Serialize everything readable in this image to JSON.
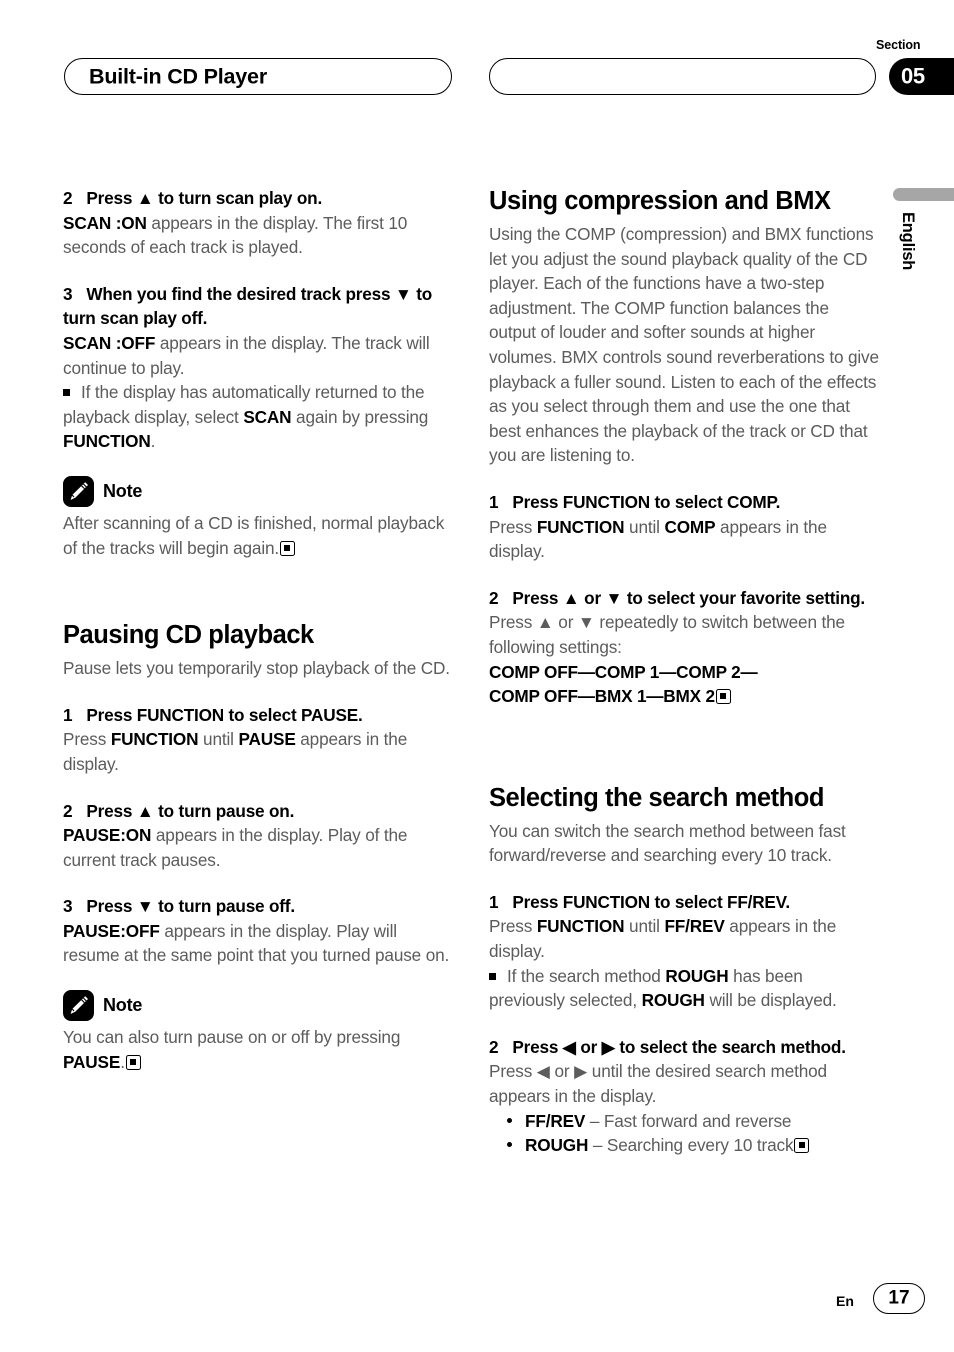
{
  "header": {
    "chapter_title": "Built-in CD Player",
    "section_label": "Section",
    "section_number": "05",
    "language_tab": "English"
  },
  "footer": {
    "language_code": "En",
    "page_number": "17"
  },
  "left_column": {
    "step2": {
      "number": "2",
      "heading": "Press ▲ to turn scan play on.",
      "body_bold": "SCAN :ON",
      "body_rest": " appears in the display. The first 10 seconds of each track is played."
    },
    "step3": {
      "number": "3",
      "heading": "When you find the desired track press ▼ to turn scan play off.",
      "body_bold": "SCAN :OFF",
      "body_rest": " appears in the display. The track will continue to play.",
      "bullet_part1": "If the display has automatically returned to the playback display, select ",
      "bullet_bold1": "SCAN",
      "bullet_part2": " again by pressing ",
      "bullet_bold2": "FUNCTION",
      "bullet_part3": "."
    },
    "note1": {
      "label": "Note",
      "text": "After scanning of a CD is finished, normal playback of the tracks will begin again."
    },
    "pausing": {
      "heading": "Pausing CD playback",
      "intro": "Pause lets you temporarily stop playback of the CD.",
      "step1": {
        "number": "1",
        "heading": "Press FUNCTION to select PAUSE.",
        "body_part1": "Press ",
        "body_bold1": "FUNCTION",
        "body_part2": " until ",
        "body_bold2": "PAUSE",
        "body_part3": " appears in the display."
      },
      "step2": {
        "number": "2",
        "heading": "Press ▲ to turn pause on.",
        "body_bold": "PAUSE:ON",
        "body_rest": " appears in the display. Play of the current track pauses."
      },
      "step3": {
        "number": "3",
        "heading": "Press ▼ to turn pause off.",
        "body_bold": "PAUSE:OFF",
        "body_rest": " appears in the display. Play will resume at the same point that you turned pause on."
      }
    },
    "note2": {
      "label": "Note",
      "text_part1": "You can also turn pause on or off by pressing ",
      "text_bold": "PAUSE",
      "text_part2": "."
    }
  },
  "right_column": {
    "compression": {
      "heading": "Using compression and BMX",
      "intro": "Using the COMP (compression) and BMX functions let you adjust the sound playback quality of the CD player. Each of the functions have a two-step adjustment. The COMP function balances the output of louder and softer sounds at higher volumes. BMX controls sound reverberations to give playback a fuller sound. Listen to each of the effects as you select through them and use the one that best enhances the playback of the track or CD that you are listening to.",
      "step1": {
        "number": "1",
        "heading": "Press FUNCTION to select COMP.",
        "body_part1": "Press ",
        "body_bold1": "FUNCTION",
        "body_part2": " until ",
        "body_bold2": "COMP",
        "body_part3": " appears in the display."
      },
      "step2": {
        "number": "2",
        "heading": "Press ▲ or ▼ to select your favorite setting.",
        "body_part1": "Press ▲ or ▼ repeatedly to switch between the following settings:",
        "settings_line1": "COMP OFF—COMP 1—COMP 2—",
        "settings_line2": "COMP OFF—BMX 1—BMX 2"
      }
    },
    "search": {
      "heading": "Selecting the search method",
      "intro": "You can switch the search method between fast forward/reverse and searching every 10 track.",
      "step1": {
        "number": "1",
        "heading": "Press FUNCTION to select FF/REV.",
        "body_part1": "Press ",
        "body_bold1": "FUNCTION",
        "body_part2": " until ",
        "body_bold2": "FF/REV",
        "body_part3": " appears in the display.",
        "bullet_part1": "If the search method ",
        "bullet_bold1": "ROUGH",
        "bullet_part2": " has been previously selected, ",
        "bullet_bold2": "ROUGH",
        "bullet_part3": " will be displayed."
      },
      "step2": {
        "number": "2",
        "heading": "Press ◀ or ▶ to select the search method.",
        "body": "Press ◀ or ▶ until the desired search method appears in the display.",
        "options": [
          {
            "term": "FF/REV",
            "desc": " – Fast forward and reverse"
          },
          {
            "term": "ROUGH",
            "desc": " – Searching every 10 track"
          }
        ]
      }
    }
  }
}
